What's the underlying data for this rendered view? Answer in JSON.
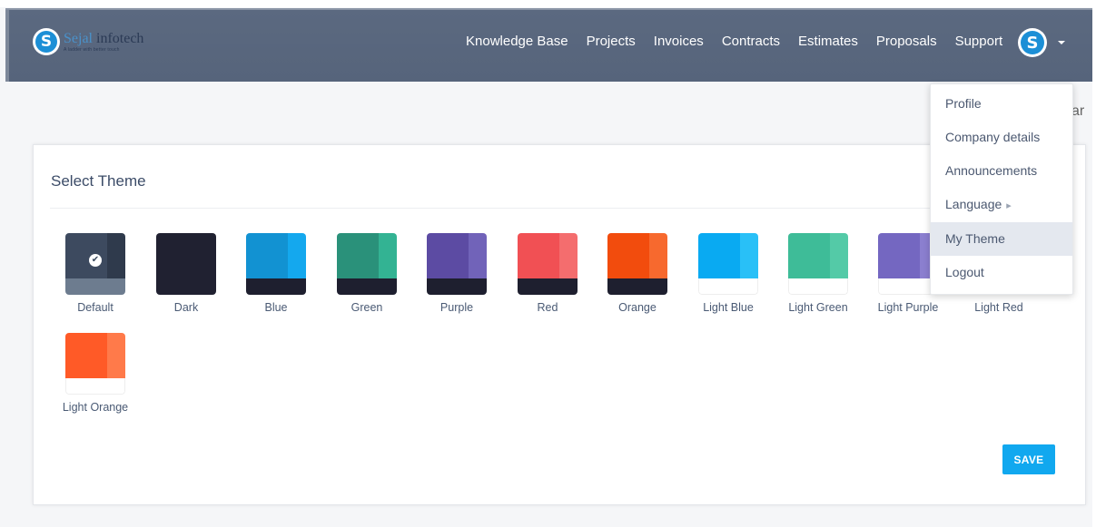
{
  "header": {
    "logo": {
      "letter": "S",
      "name_a": "Sejal",
      "name_b": " infotech",
      "tagline": "A ladder with better touch"
    },
    "nav": [
      "Knowledge Base",
      "Projects",
      "Invoices",
      "Contracts",
      "Estimates",
      "Proposals",
      "Support"
    ],
    "avatar_letter": "S"
  },
  "partial_text": "ar",
  "card": {
    "title": "Select Theme",
    "selected_theme": "Default",
    "themes": [
      {
        "label": "Default",
        "color_main": "#3d4a5f",
        "color_side": "#2f3a4c",
        "color_bottom": "#6d7c8f",
        "light": false
      },
      {
        "label": "Dark",
        "color_main": "#202131",
        "color_side": "#202131",
        "color_bottom": "#202131",
        "light": false
      },
      {
        "label": "Blue",
        "color_main": "#1292d2",
        "color_side": "#14a8ee",
        "color_bottom": "#1e1f2f",
        "light": false
      },
      {
        "label": "Green",
        "color_main": "#2a917a",
        "color_side": "#33b393",
        "color_bottom": "#1e1f2f",
        "light": false
      },
      {
        "label": "Purple",
        "color_main": "#5c4ba3",
        "color_side": "#7163b9",
        "color_bottom": "#1e1f2f",
        "light": false
      },
      {
        "label": "Red",
        "color_main": "#f15054",
        "color_side": "#f46d6e",
        "color_bottom": "#1e1f2f",
        "light": false
      },
      {
        "label": "Orange",
        "color_main": "#f24c0d",
        "color_side": "#f7692e",
        "color_bottom": "#1e1f2f",
        "light": false
      },
      {
        "label": "Light Blue",
        "color_main": "#09aaf2",
        "color_side": "#29c0f7",
        "color_bottom": "#ffffff",
        "light": true
      },
      {
        "label": "Light Green",
        "color_main": "#3ebc98",
        "color_side": "#54caa7",
        "color_bottom": "#ffffff",
        "light": true
      },
      {
        "label": "Light Purple",
        "color_main": "#7467c1",
        "color_side": "#8b7fcf",
        "color_bottom": "#ffffff",
        "light": true
      },
      {
        "label": "Light Red",
        "color_main": "#f15054",
        "color_side": "#f46d6e",
        "color_bottom": "#ffffff",
        "light": true
      },
      {
        "label": "Light Orange",
        "color_main": "#ff5a27",
        "color_side": "#ff7a4a",
        "color_bottom": "#ffffff",
        "light": true
      }
    ],
    "save_label": "SAVE"
  },
  "dropdown": {
    "items": [
      {
        "label": "Profile",
        "active": false,
        "submenu": false
      },
      {
        "label": "Company details",
        "active": false,
        "submenu": false
      },
      {
        "label": "Announcements",
        "active": false,
        "submenu": false
      },
      {
        "label": "Language",
        "active": false,
        "submenu": true
      },
      {
        "label": "My Theme",
        "active": true,
        "submenu": false
      },
      {
        "label": "Logout",
        "active": false,
        "submenu": false
      }
    ],
    "submenu_icon": "chevron-right-icon"
  },
  "colors": {
    "header_bg": "#58667d",
    "accent": "#11a8ef",
    "text_muted": "#4a5a74"
  }
}
